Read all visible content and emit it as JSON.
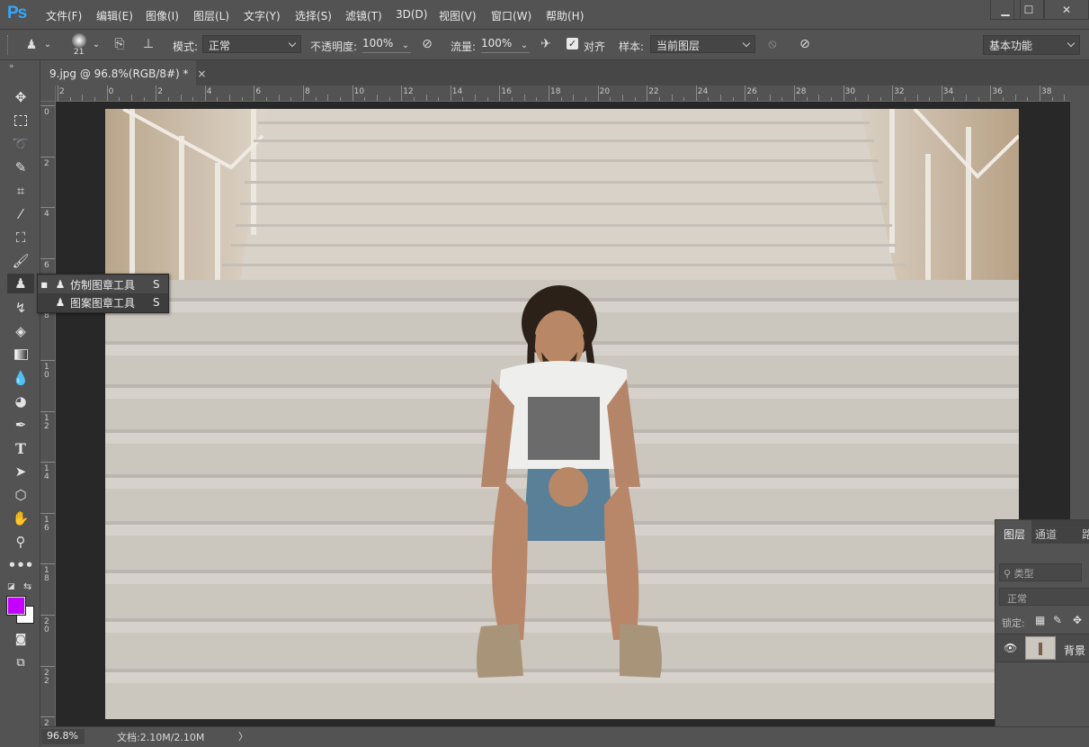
{
  "app": {
    "logo": "Ps"
  },
  "menu": [
    "文件(F)",
    "编辑(E)",
    "图像(I)",
    "图层(L)",
    "文字(Y)",
    "选择(S)",
    "滤镜(T)",
    "3D(D)",
    "视图(V)",
    "窗口(W)",
    "帮助(H)"
  ],
  "window_controls": {
    "minimize": "minimize-icon",
    "maximize": "maximize-icon",
    "close": "close-icon"
  },
  "options": {
    "brush_size": "21",
    "mode_label": "模式:",
    "mode_value": "正常",
    "opacity_label": "不透明度:",
    "opacity_value": "100%",
    "flow_label": "流量:",
    "flow_value": "100%",
    "align_label": "对齐",
    "align_checked": true,
    "sample_label": "样本:",
    "sample_value": "当前图层",
    "workspace": "基本功能"
  },
  "document_tab": {
    "title": "9.jpg @ 96.8%(RGB/8#) *",
    "close": "×"
  },
  "ruler_h": [
    "2",
    "0",
    "2",
    "4",
    "6",
    "8",
    "10",
    "12",
    "14",
    "16",
    "18",
    "20",
    "22",
    "24",
    "26",
    "28",
    "30",
    "32",
    "34",
    "36",
    "38"
  ],
  "ruler_v": [
    "0",
    "2",
    "4",
    "6",
    "8",
    "1\n0",
    "1\n2",
    "1\n4",
    "1\n6",
    "1\n8",
    "2\n0",
    "2\n2",
    "2\n4"
  ],
  "tools": [
    "move",
    "marquee",
    "lasso",
    "quick-select",
    "crop",
    "eyedropper",
    "patch",
    "brush",
    "clone-stamp",
    "history-brush",
    "eraser",
    "gradient",
    "blur",
    "dodge",
    "pen",
    "type",
    "path-select",
    "shape",
    "hand",
    "zoom",
    "more"
  ],
  "colors": {
    "foreground": "#c400ff",
    "background": "#ffffff",
    "accent": "#31a8ff"
  },
  "flyout": {
    "items": [
      {
        "label": "仿制图章工具",
        "shortcut": "S",
        "active": true
      },
      {
        "label": "图案图章工具",
        "shortcut": "S",
        "active": false
      }
    ]
  },
  "status": {
    "zoom": "96.8%",
    "doc_size": "文档:2.10M/2.10M",
    "arrow": "〉"
  },
  "layers_panel": {
    "tabs": [
      "图层",
      "通道",
      "路"
    ],
    "filter_placeholder": "类型",
    "blend_mode": "正常",
    "lock_label": "锁定:",
    "layer_name": "背景",
    "footer": [
      "link-icon",
      "fx",
      "mask-icon"
    ]
  }
}
